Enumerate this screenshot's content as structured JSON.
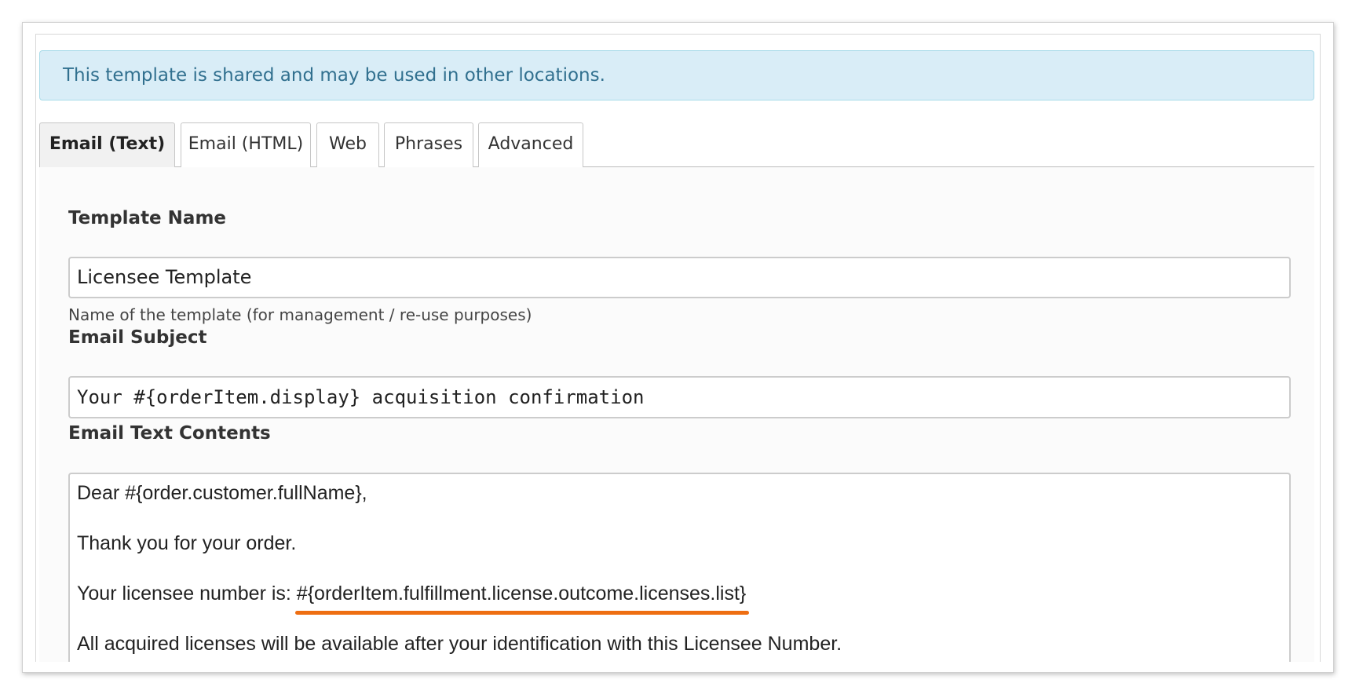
{
  "alert": {
    "text": "This template is shared and may be used in other locations.",
    "color": "#d9edf7"
  },
  "tabs": [
    {
      "label": "Email (Text)",
      "active": true
    },
    {
      "label": "Email (HTML)",
      "active": false
    },
    {
      "label": "Web",
      "active": false
    },
    {
      "label": "Phrases",
      "active": false
    },
    {
      "label": "Advanced",
      "active": false
    }
  ],
  "form": {
    "template_name": {
      "label": "Template Name",
      "value": "Licensee Template",
      "help": "Name of the template (for management / re-use purposes)"
    },
    "email_subject": {
      "label": "Email Subject",
      "value": "Your #{orderItem.display} acquisition confirmation"
    },
    "email_text": {
      "label": "Email Text Contents",
      "line1": "Dear #{order.customer.fullName},",
      "line2": "Thank you for your order.",
      "line3_prefix": "Your licensee number is: ",
      "line3_highlight": "#{orderItem.fulfillment.license.outcome.licenses.list}",
      "line4": "All acquired licenses will be available after your identification with this Licensee Number.",
      "highlight_color": "#ee6e12"
    }
  }
}
